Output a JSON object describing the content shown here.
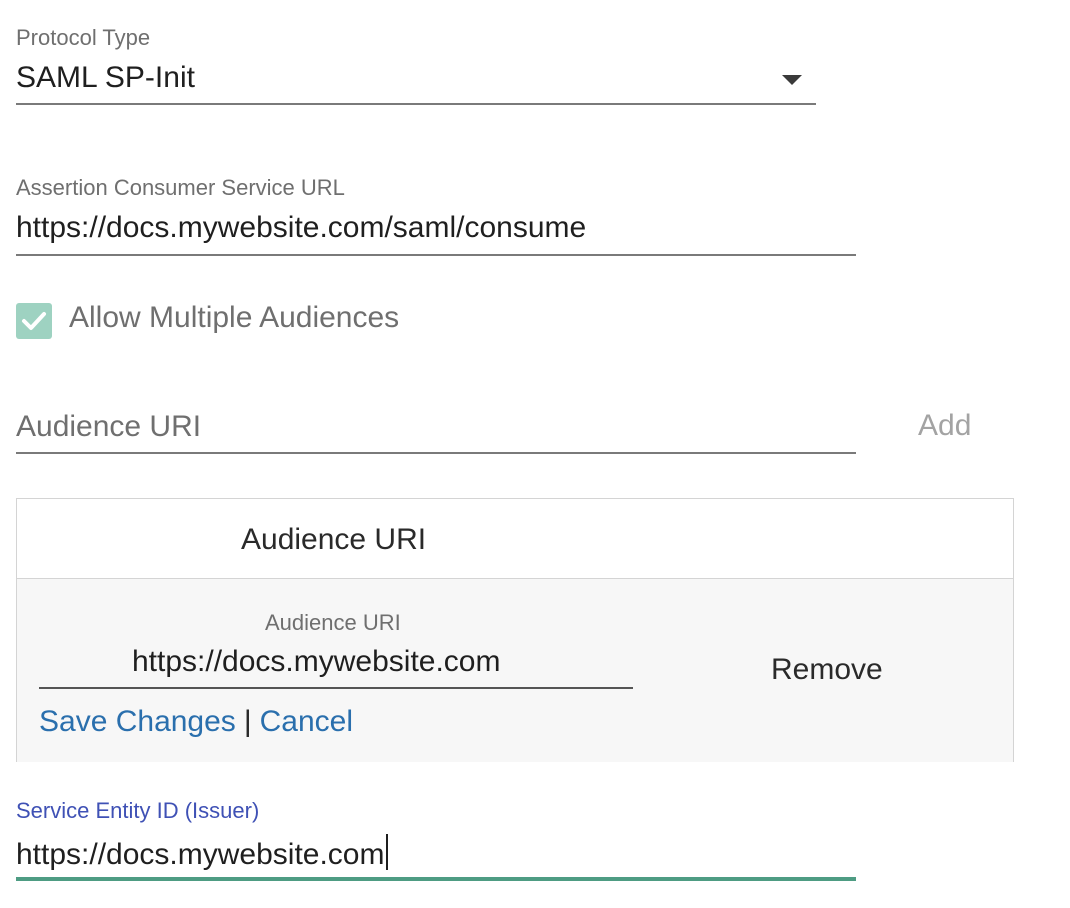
{
  "protocol": {
    "label": "Protocol Type",
    "value": "SAML SP-Init"
  },
  "acs": {
    "label": "Assertion Consumer Service URL",
    "value": "https://docs.mywebsite.com/saml/consume"
  },
  "multiple_audiences": {
    "label": "Allow Multiple Audiences",
    "checked": true
  },
  "audience_input": {
    "placeholder": "Audience URI",
    "value": "",
    "add_label": "Add"
  },
  "audience_table": {
    "header": "Audience URI",
    "row": {
      "field_label": "Audience URI",
      "value": "https://docs.mywebsite.com",
      "remove_label": "Remove",
      "save_label": "Save Changes",
      "separator": "|",
      "cancel_label": "Cancel"
    }
  },
  "issuer": {
    "label": "Service Entity ID (Issuer)",
    "value": "https://docs.mywebsite.com"
  },
  "colors": {
    "checkbox": "#9ed2c1",
    "link": "#2a6fad",
    "focus_label": "#3f51b5",
    "focus_underline": "#4e9c83"
  },
  "icons": {
    "dropdown": "dropdown-arrow-icon",
    "check": "checkmark-icon"
  }
}
